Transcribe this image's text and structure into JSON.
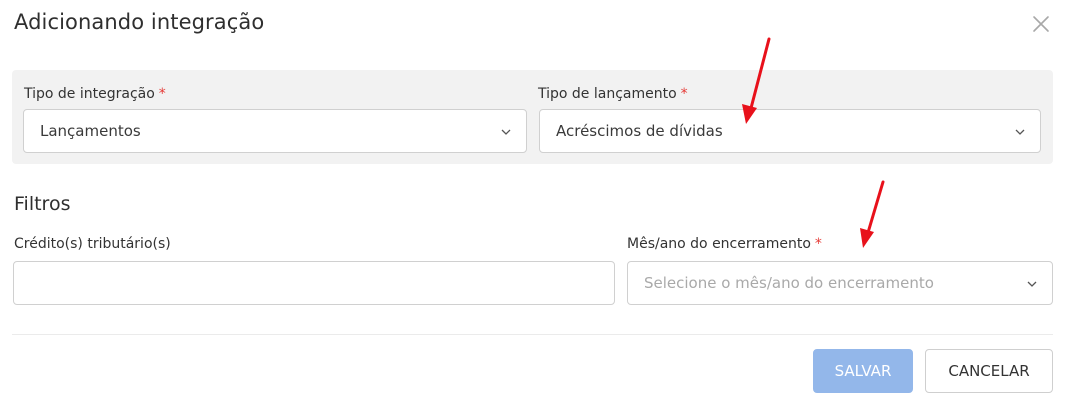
{
  "dialog": {
    "title": "Adicionando integração",
    "close_icon": "close-icon"
  },
  "integration": {
    "tipo_integracao": {
      "label": "Tipo de integração",
      "required": "*",
      "value": "Lançamentos"
    },
    "tipo_lancamento": {
      "label": "Tipo de lançamento",
      "required": "*",
      "value": "Acréscimos de dívidas"
    }
  },
  "filters": {
    "title": "Filtros",
    "creditos": {
      "label": "Crédito(s) tributário(s)",
      "value": ""
    },
    "mes_ano": {
      "label": "Mês/ano do encerramento",
      "required": "*",
      "placeholder": "Selecione o mês/ano do encerramento"
    }
  },
  "actions": {
    "save_label": "SALVAR",
    "cancel_label": "CANCELAR"
  },
  "colors": {
    "required": "#e53935",
    "primary_disabled": "#93b7ea",
    "annotation_arrow": "#e8111b"
  }
}
